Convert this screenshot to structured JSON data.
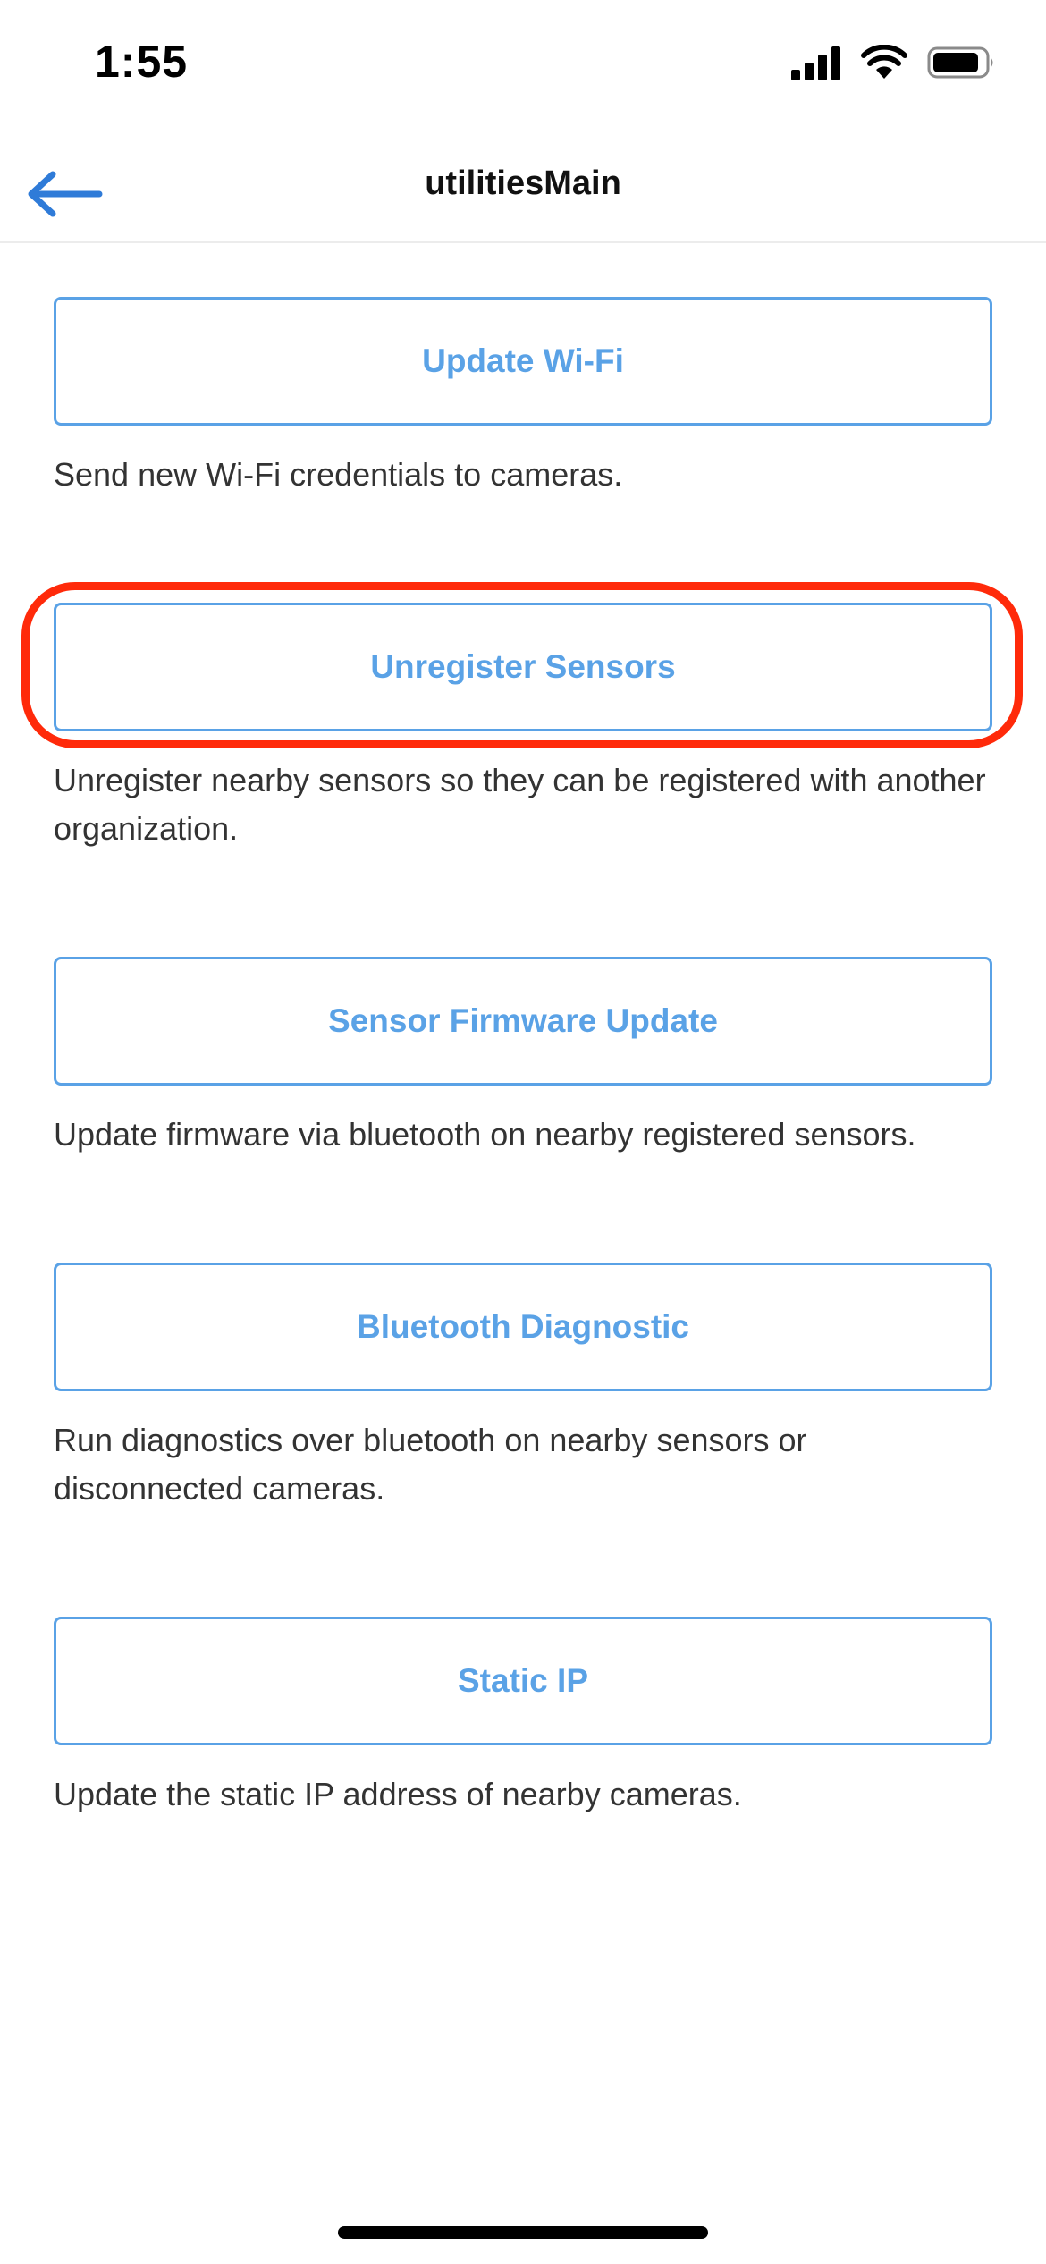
{
  "status_bar": {
    "time": "1:55",
    "icons": [
      "signal-icon",
      "wifi-icon",
      "battery-icon"
    ]
  },
  "header": {
    "back_icon": "arrow-left-icon",
    "title": "utilitiesMain"
  },
  "utilities": [
    {
      "label": "Update Wi-Fi",
      "description": "Send new Wi-Fi credentials to cameras."
    },
    {
      "label": "Unregister Sensors",
      "description": "Unregister nearby sensors so they can be registered with another organization."
    },
    {
      "label": "Sensor Firmware Update",
      "description": "Update firmware via bluetooth on nearby registered sensors."
    },
    {
      "label": "Bluetooth Diagnostic",
      "description": "Run diagnostics over bluetooth on nearby sensors or disconnected cameras."
    },
    {
      "label": "Static IP",
      "description": "Update the static IP address of nearby cameras."
    }
  ],
  "colors": {
    "accent": "#5aa2e6",
    "back_arrow": "#2f7bd8",
    "highlight": "#ff2a0a",
    "text": "#333333"
  }
}
